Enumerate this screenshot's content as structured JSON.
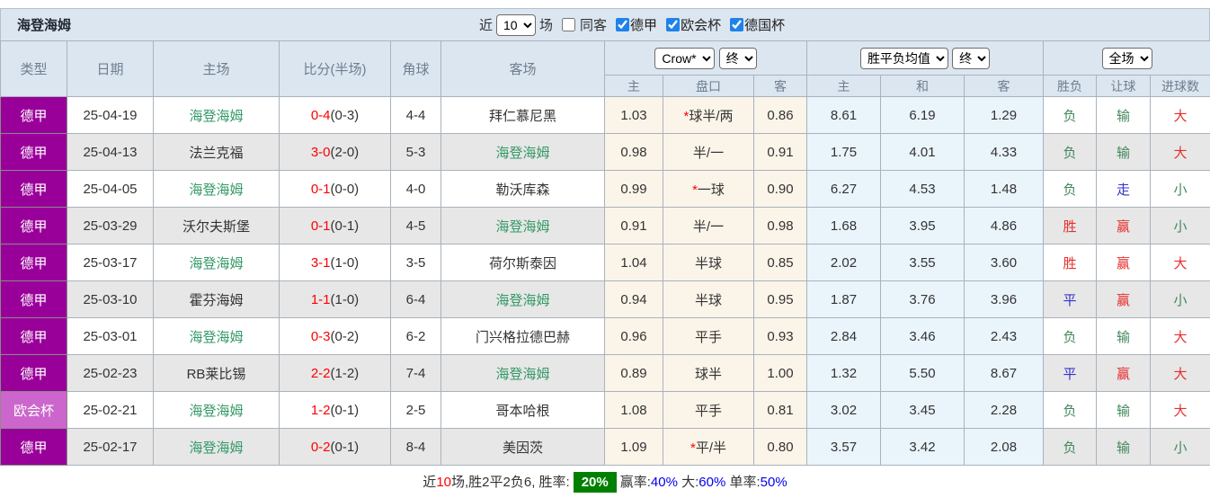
{
  "title": "海登海姆",
  "toolbar": {
    "recent_label": "近",
    "count_value": "10",
    "matches_label": "场",
    "same_venue": {
      "label": "同客",
      "checked": false
    },
    "leagues": [
      {
        "label": "德甲",
        "checked": true
      },
      {
        "label": "欧会杯",
        "checked": true
      },
      {
        "label": "德国杯",
        "checked": true
      }
    ]
  },
  "header": {
    "columns": [
      "类型",
      "日期",
      "主场",
      "比分(半场)",
      "角球",
      "客场"
    ],
    "groups": [
      {
        "selects": [
          "Crow*",
          "终"
        ],
        "sub": [
          "主",
          "盘口",
          "客"
        ]
      },
      {
        "selects": [
          "胜平负均值",
          "终"
        ],
        "sub": [
          "主",
          "和",
          "客"
        ]
      },
      {
        "selects": [
          "全场"
        ],
        "sub": [
          "胜负",
          "让球",
          "进球数"
        ]
      }
    ]
  },
  "rows": [
    {
      "type": "德甲",
      "type_light": false,
      "date": "25-04-19",
      "home": "海登海姆",
      "home_team": true,
      "score": "0-4",
      "half": "(0-3)",
      "corner": "4-4",
      "away": "拜仁慕尼黑",
      "away_team": false,
      "crow_home": "1.03",
      "handicap": "球半/两",
      "handicap_star": true,
      "crow_away": "0.86",
      "avg_home": "8.61",
      "avg_draw": "6.19",
      "avg_away": "1.29",
      "result": "负",
      "result_c": "green",
      "let": "输",
      "let_c": "green",
      "goal": "大",
      "goal_c": "red"
    },
    {
      "type": "德甲",
      "type_light": false,
      "date": "25-04-13",
      "home": "法兰克福",
      "home_team": false,
      "score": "3-0",
      "half": "(2-0)",
      "corner": "5-3",
      "away": "海登海姆",
      "away_team": true,
      "crow_home": "0.98",
      "handicap": "半/一",
      "handicap_star": false,
      "crow_away": "0.91",
      "avg_home": "1.75",
      "avg_draw": "4.01",
      "avg_away": "4.33",
      "result": "负",
      "result_c": "green",
      "let": "输",
      "let_c": "green",
      "goal": "大",
      "goal_c": "red"
    },
    {
      "type": "德甲",
      "type_light": false,
      "date": "25-04-05",
      "home": "海登海姆",
      "home_team": true,
      "score": "0-1",
      "half": "(0-0)",
      "corner": "4-0",
      "away": "勒沃库森",
      "away_team": false,
      "crow_home": "0.99",
      "handicap": "一球",
      "handicap_star": true,
      "crow_away": "0.90",
      "avg_home": "6.27",
      "avg_draw": "4.53",
      "avg_away": "1.48",
      "result": "负",
      "result_c": "green",
      "let": "走",
      "let_c": "blue",
      "goal": "小",
      "goal_c": "green"
    },
    {
      "type": "德甲",
      "type_light": false,
      "date": "25-03-29",
      "home": "沃尔夫斯堡",
      "home_team": false,
      "score": "0-1",
      "half": "(0-1)",
      "corner": "4-5",
      "away": "海登海姆",
      "away_team": true,
      "crow_home": "0.91",
      "handicap": "半/一",
      "handicap_star": false,
      "crow_away": "0.98",
      "avg_home": "1.68",
      "avg_draw": "3.95",
      "avg_away": "4.86",
      "result": "胜",
      "result_c": "red",
      "let": "赢",
      "let_c": "red",
      "goal": "小",
      "goal_c": "green"
    },
    {
      "type": "德甲",
      "type_light": false,
      "date": "25-03-17",
      "home": "海登海姆",
      "home_team": true,
      "score": "3-1",
      "half": "(1-0)",
      "corner": "3-5",
      "away": "荷尔斯泰因",
      "away_team": false,
      "crow_home": "1.04",
      "handicap": "半球",
      "handicap_star": false,
      "crow_away": "0.85",
      "avg_home": "2.02",
      "avg_draw": "3.55",
      "avg_away": "3.60",
      "result": "胜",
      "result_c": "red",
      "let": "赢",
      "let_c": "red",
      "goal": "大",
      "goal_c": "red"
    },
    {
      "type": "德甲",
      "type_light": false,
      "date": "25-03-10",
      "home": "霍芬海姆",
      "home_team": false,
      "score": "1-1",
      "half": "(1-0)",
      "corner": "6-4",
      "away": "海登海姆",
      "away_team": true,
      "crow_home": "0.94",
      "handicap": "半球",
      "handicap_star": false,
      "crow_away": "0.95",
      "avg_home": "1.87",
      "avg_draw": "3.76",
      "avg_away": "3.96",
      "result": "平",
      "result_c": "blue",
      "let": "赢",
      "let_c": "red",
      "goal": "小",
      "goal_c": "green"
    },
    {
      "type": "德甲",
      "type_light": false,
      "date": "25-03-01",
      "home": "海登海姆",
      "home_team": true,
      "score": "0-3",
      "half": "(0-2)",
      "corner": "6-2",
      "away": "门兴格拉德巴赫",
      "away_team": false,
      "crow_home": "0.96",
      "handicap": "平手",
      "handicap_star": false,
      "crow_away": "0.93",
      "avg_home": "2.84",
      "avg_draw": "3.46",
      "avg_away": "2.43",
      "result": "负",
      "result_c": "green",
      "let": "输",
      "let_c": "green",
      "goal": "大",
      "goal_c": "red"
    },
    {
      "type": "德甲",
      "type_light": false,
      "date": "25-02-23",
      "home": "RB莱比锡",
      "home_team": false,
      "score": "2-2",
      "half": "(1-2)",
      "corner": "7-4",
      "away": "海登海姆",
      "away_team": true,
      "crow_home": "0.89",
      "handicap": "球半",
      "handicap_star": false,
      "crow_away": "1.00",
      "avg_home": "1.32",
      "avg_draw": "5.50",
      "avg_away": "8.67",
      "result": "平",
      "result_c": "blue",
      "let": "赢",
      "let_c": "red",
      "goal": "大",
      "goal_c": "red"
    },
    {
      "type": "欧会杯",
      "type_light": true,
      "date": "25-02-21",
      "home": "海登海姆",
      "home_team": true,
      "score": "1-2",
      "half": "(0-1)",
      "corner": "2-5",
      "away": "哥本哈根",
      "away_team": false,
      "crow_home": "1.08",
      "handicap": "平手",
      "handicap_star": false,
      "crow_away": "0.81",
      "avg_home": "3.02",
      "avg_draw": "3.45",
      "avg_away": "2.28",
      "result": "负",
      "result_c": "green",
      "let": "输",
      "let_c": "green",
      "goal": "大",
      "goal_c": "red"
    },
    {
      "type": "德甲",
      "type_light": false,
      "date": "25-02-17",
      "home": "海登海姆",
      "home_team": true,
      "score": "0-2",
      "half": "(0-1)",
      "corner": "8-4",
      "away": "美因茨",
      "away_team": false,
      "crow_home": "1.09",
      "handicap": "平/半",
      "handicap_star": true,
      "crow_away": "0.80",
      "avg_home": "3.57",
      "avg_draw": "3.42",
      "avg_away": "2.08",
      "result": "负",
      "result_c": "green",
      "let": "输",
      "let_c": "green",
      "goal": "小",
      "goal_c": "green"
    }
  ],
  "footer": {
    "parts": [
      {
        "text": "近",
        "c": "k"
      },
      {
        "text": "10",
        "c": "r"
      },
      {
        "text": "场,胜2平2负6, 胜率:",
        "c": "k"
      },
      {
        "text": "20%",
        "c": "badge"
      },
      {
        "text": "赢率:",
        "c": "k"
      },
      {
        "text": "40%",
        "c": "b"
      },
      {
        "text": " 大:",
        "c": "k"
      },
      {
        "text": "60%",
        "c": "b"
      },
      {
        "text": " 单率:",
        "c": "k"
      },
      {
        "text": "50%",
        "c": "b"
      }
    ]
  },
  "colors": {
    "league_purple": "#990099",
    "league_purple_light": "#cc66cc",
    "team_green": "#339966",
    "score_red": "#ff0000",
    "result_red": "#e62e2e",
    "result_green": "#44885c",
    "result_blue": "#3333cc",
    "goal_red": "#ff6666",
    "crow_bg": "#fbf4e9",
    "avg_bg": "#eaf4fb",
    "header_bg": "#dce6f1",
    "badge_green": "#008000",
    "stat_blue": "#0000ee"
  }
}
